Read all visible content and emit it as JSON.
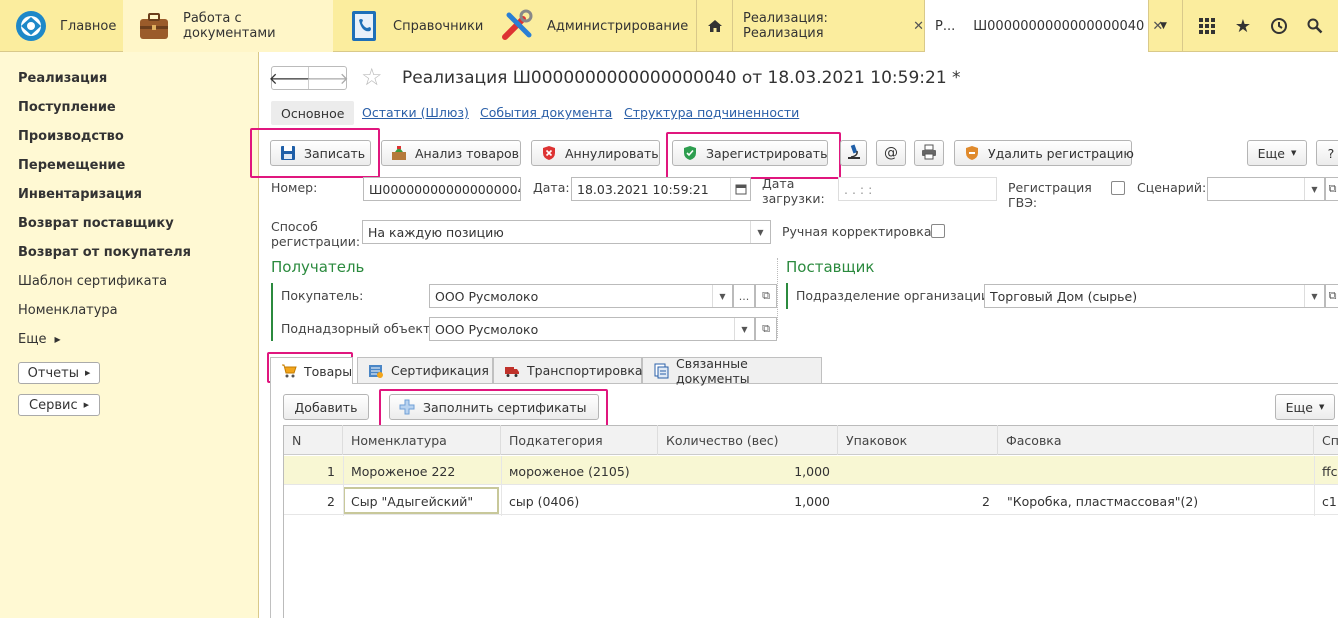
{
  "sections": {
    "home": "Главное",
    "docs": "Работа с документами",
    "refs": "Справочники",
    "admin": "Администрирование"
  },
  "open_tabs": [
    {
      "label": "Реализация: Реализация"
    },
    {
      "label": "Р...",
      "title": "Ш0000000000000000040"
    }
  ],
  "left_nav": {
    "items": [
      "Реализация",
      "Поступление",
      "Производство",
      "Перемещение",
      "Инвентаризация",
      "Возврат поставщику",
      "Возврат от покупателя",
      "Шаблон сертификата",
      "Номенклатура",
      "Еще"
    ],
    "reports": "Отчеты",
    "service": "Сервис"
  },
  "doc": {
    "title": "Реализация Ш0000000000000000040 от 18.03.2021 10:59:21 *",
    "subtabs": [
      "Основное",
      "Остатки (Шлюз)",
      "События документа",
      "Структура подчиненности"
    ]
  },
  "toolbar": {
    "save": "Записать",
    "analyze": "Анализ товаров",
    "cancel": "Аннулировать",
    "register": "Зарегистрировать",
    "delete_reg": "Удалить регистрацию",
    "more": "Еще",
    "help": "?"
  },
  "fields": {
    "number_label": "Номер:",
    "number": "Ш0000000000000000040",
    "date_label": "Дата:",
    "date": "18.03.2021 10:59:21",
    "load_date_label": "Дата загрузки:",
    "load_date": ". .   : :",
    "gve_label": "Регистрация ГВЭ:",
    "scenario_label": "Сценарий:",
    "method_label": "Способ регистрации:",
    "method": "На каждую позицию",
    "manual_label": "Ручная корректировка:"
  },
  "recipient": {
    "title": "Получатель",
    "buyer_label": "Покупатель:",
    "buyer": "ООО Русмолоко",
    "object_label": "Поднадзорный объект:",
    "object": "ООО Русмолоко"
  },
  "supplier": {
    "title": "Поставщик",
    "dept_label": "Подразделение организации:",
    "dept": "Торговый Дом (сырье)"
  },
  "form_tabs": [
    "Товары",
    "Сертификация",
    "Транспортировка",
    "Связанные документы"
  ],
  "table_toolbar": {
    "add": "Добавить",
    "fill": "Заполнить сертификаты",
    "more": "Еще"
  },
  "table": {
    "columns": [
      "N",
      "Номенклатура",
      "Подкатегория",
      "Количество (вес)",
      "Упаковок",
      "Фасовка",
      "Сп"
    ],
    "rows": [
      {
        "n": "1",
        "name": "Мороженое 222",
        "sub": "мороженое (2105)",
        "qty": "1,000",
        "packs": "",
        "fas": "",
        "extra": "ffc"
      },
      {
        "n": "2",
        "name": "Сыр \"Адыгейский\"",
        "sub": "сыр (0406)",
        "qty": "1,000",
        "packs": "2",
        "fas": "\"Коробка, пластмассовая\"(2)",
        "extra": "c1"
      }
    ]
  },
  "colors": {
    "topbar": "#fbed9e",
    "left_panel": "#fff9d3",
    "highlight": "#e0167e",
    "group_heading": "#2b8a3e",
    "selected_row": "#f8f7d3"
  }
}
